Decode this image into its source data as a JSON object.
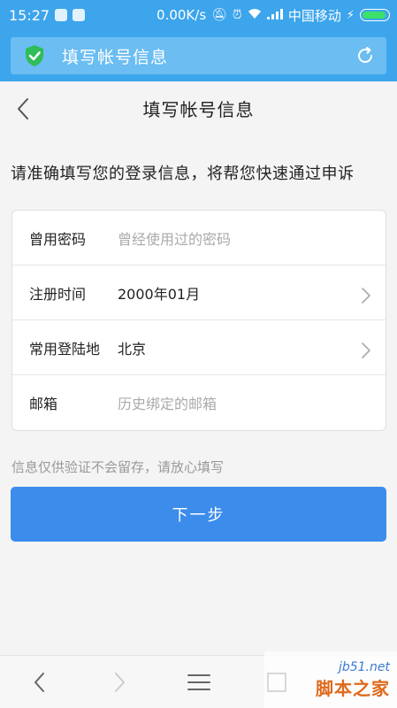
{
  "status_bar": {
    "time": "15:27",
    "network_speed": "0.00K/s",
    "carrier": "中国移动"
  },
  "browser": {
    "page_title": "填写帐号信息"
  },
  "header": {
    "title": "填写帐号信息"
  },
  "instruction": "请准确填写您的登录信息，将帮您快速通过申诉",
  "form": {
    "rows": [
      {
        "label": "曾用密码",
        "value": "",
        "placeholder": "曾经使用过的密码"
      },
      {
        "label": "注册时间",
        "value": "2000年01月",
        "placeholder": ""
      },
      {
        "label": "常用登陆地",
        "value": "北京",
        "placeholder": ""
      },
      {
        "label": "邮箱",
        "value": "",
        "placeholder": "历史绑定的邮箱"
      }
    ]
  },
  "hint": "信息仅供验证不会留存，请放心填写",
  "next_button": "下一步",
  "watermark": {
    "site": "jb51.net",
    "name": "脚本之家"
  },
  "colors": {
    "status_bar": "#3ca5ec",
    "url_bar": "#6bbdf2",
    "primary_button": "#3c8cec",
    "shield": "#2ebd59"
  }
}
